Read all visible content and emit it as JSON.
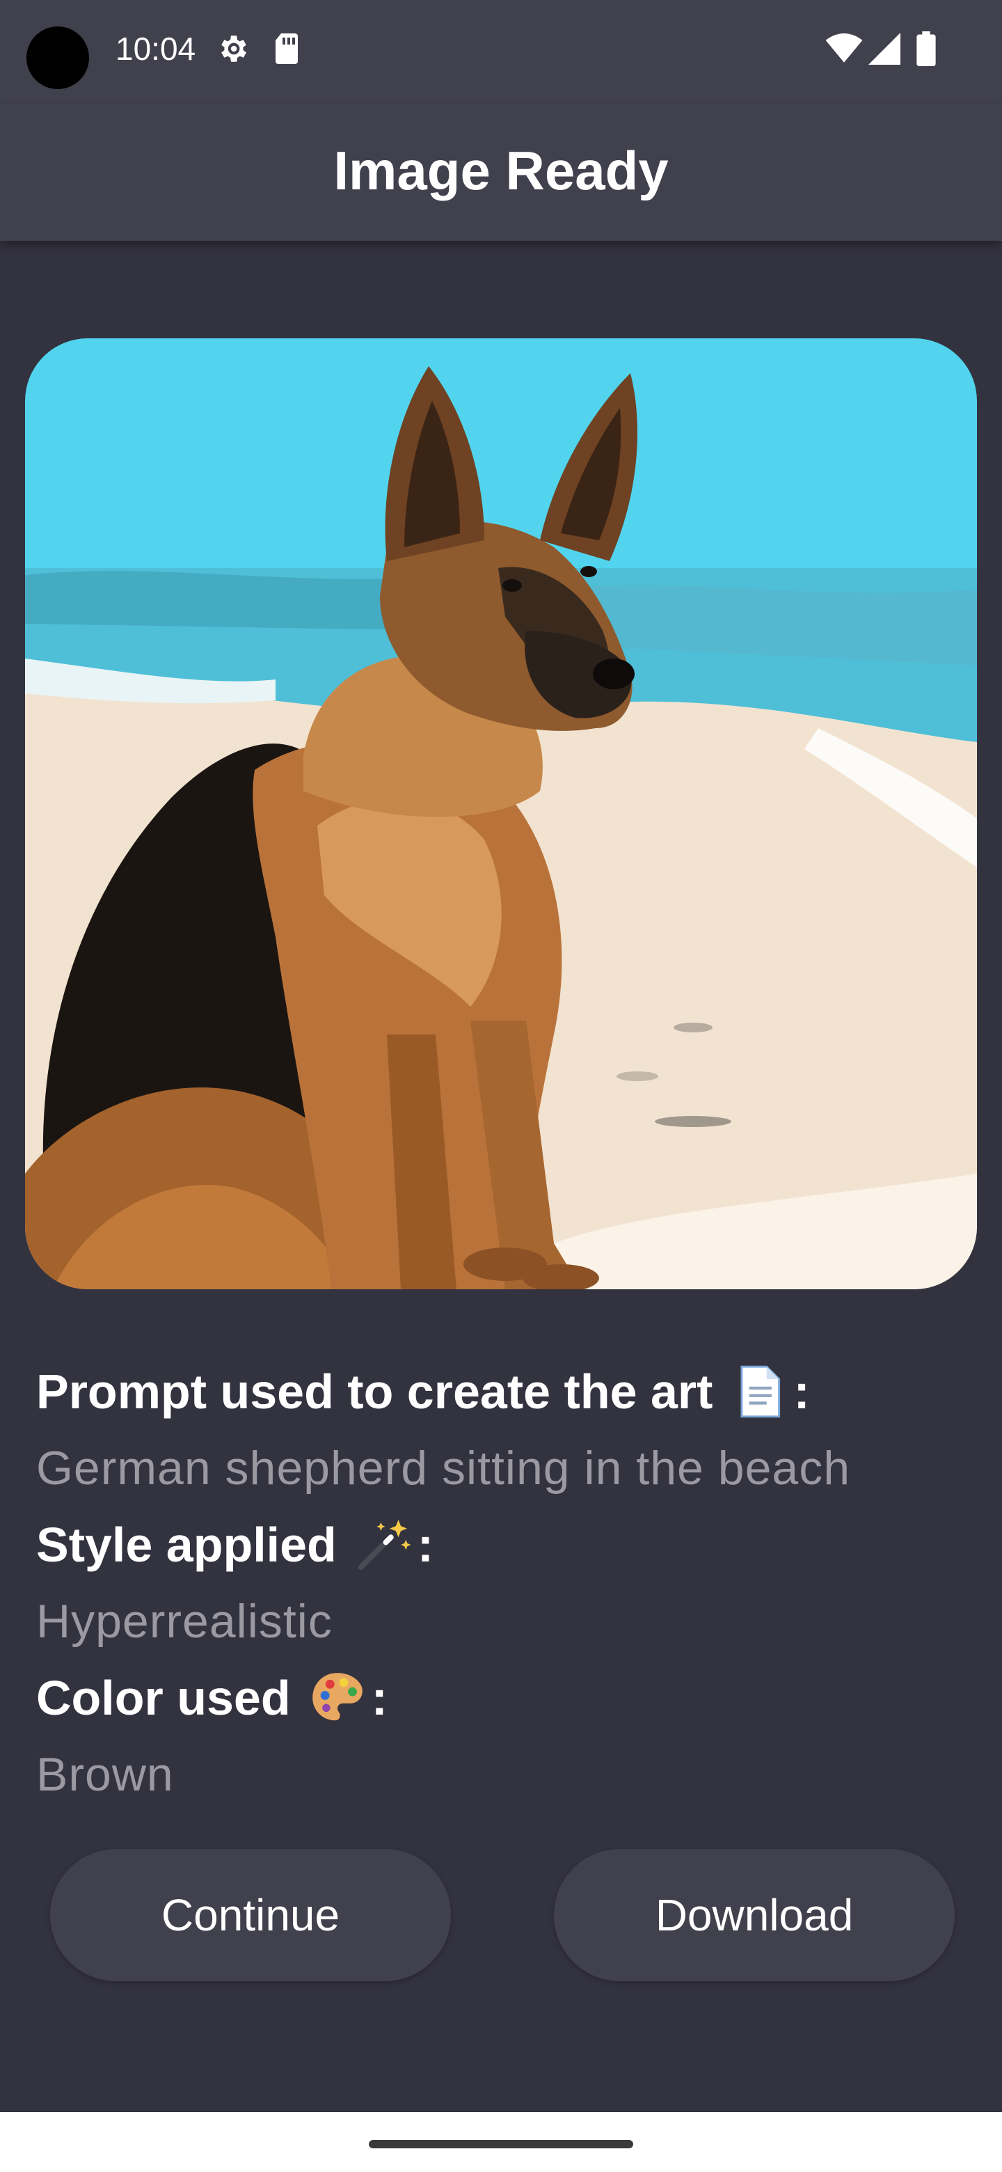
{
  "status_bar": {
    "time": "10:04",
    "icons": [
      "settings-icon",
      "sd-card-icon",
      "wifi-icon",
      "cellular-signal-icon",
      "battery-icon"
    ]
  },
  "app_bar": {
    "title": "Image Ready"
  },
  "artwork": {
    "image_subject": "dog-on-beach-painting"
  },
  "details": {
    "prompt_heading": "Prompt used to create the art",
    "prompt_emoji": "page-emoji",
    "prompt_value": "German shepherd sitting in the beach",
    "style_heading": "Style applied",
    "style_emoji": "magic-wand-emoji",
    "style_value": "Hyperrealistic",
    "color_heading": "Color used",
    "color_emoji": "palette-emoji",
    "color_value": "Brown",
    "colon": ":"
  },
  "actions": {
    "continue_label": "Continue",
    "download_label": "Download"
  },
  "colors": {
    "background": "#33323f",
    "bar": "#41404d",
    "button": "#41404d",
    "value_text": "#9b9aa3"
  }
}
